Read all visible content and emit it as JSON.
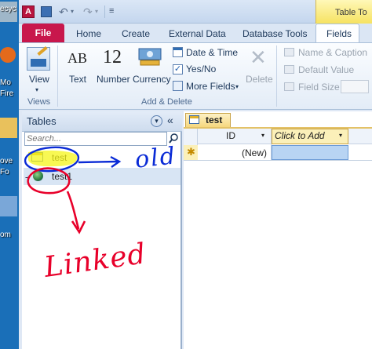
{
  "desktop": {
    "labels": [
      "ecyc",
      "Mo",
      "Fire",
      "ove",
      "Fo",
      "om"
    ]
  },
  "titlebar": {
    "app_icon_letter": "A",
    "context_tab": "Table To"
  },
  "tabs": {
    "file": "File",
    "home": "Home",
    "create": "Create",
    "external_data": "External Data",
    "database_tools": "Database Tools",
    "fields": "Fields"
  },
  "ribbon": {
    "view": {
      "label": "View",
      "group": "Views"
    },
    "text": {
      "glyph": "AB",
      "label": "Text"
    },
    "number": {
      "glyph": "12",
      "label": "Number"
    },
    "currency": {
      "label": "Currency"
    },
    "date_time": "Date & Time",
    "yes_no": "Yes/No",
    "more_fields": "More Fields",
    "delete": "Delete",
    "add_delete_group": "Add & Delete",
    "name_caption": "Name & Caption",
    "default_value": "Default Value",
    "field_size": "Field Size"
  },
  "nav_pane": {
    "title": "Tables",
    "search_placeholder": "Search...",
    "items": [
      {
        "name": "test",
        "type": "local-table"
      },
      {
        "name": "test1",
        "type": "linked-table"
      }
    ]
  },
  "datasheet": {
    "tab_title": "test",
    "columns": [
      "ID",
      "Click to Add"
    ],
    "new_row_marker": "✱",
    "new_row_value": "(New)"
  },
  "annotations": {
    "old_text": "old",
    "linked_text": "Linked",
    "pen_color": "#0a2bd6",
    "marker_color": "#e8002a",
    "highlight_color": "#f5f51a"
  }
}
